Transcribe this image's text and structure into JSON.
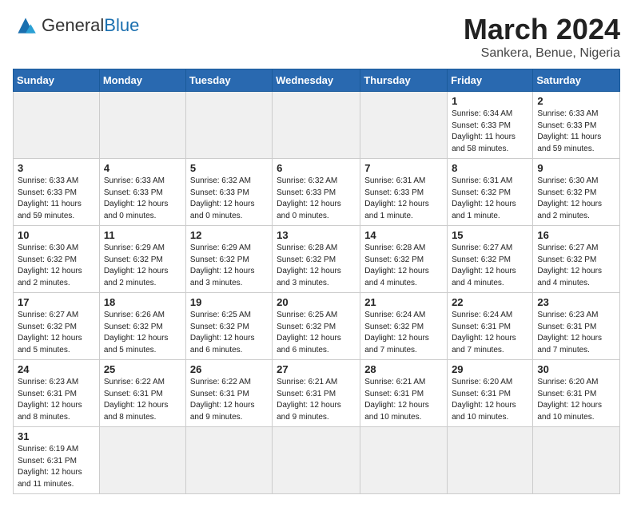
{
  "logo": {
    "text_general": "General",
    "text_blue": "Blue"
  },
  "title": "March 2024",
  "subtitle": "Sankera, Benue, Nigeria",
  "weekdays": [
    "Sunday",
    "Monday",
    "Tuesday",
    "Wednesday",
    "Thursday",
    "Friday",
    "Saturday"
  ],
  "weeks": [
    [
      {
        "day": "",
        "info": ""
      },
      {
        "day": "",
        "info": ""
      },
      {
        "day": "",
        "info": ""
      },
      {
        "day": "",
        "info": ""
      },
      {
        "day": "",
        "info": ""
      },
      {
        "day": "1",
        "info": "Sunrise: 6:34 AM\nSunset: 6:33 PM\nDaylight: 11 hours\nand 58 minutes."
      },
      {
        "day": "2",
        "info": "Sunrise: 6:33 AM\nSunset: 6:33 PM\nDaylight: 11 hours\nand 59 minutes."
      }
    ],
    [
      {
        "day": "3",
        "info": "Sunrise: 6:33 AM\nSunset: 6:33 PM\nDaylight: 11 hours\nand 59 minutes."
      },
      {
        "day": "4",
        "info": "Sunrise: 6:33 AM\nSunset: 6:33 PM\nDaylight: 12 hours\nand 0 minutes."
      },
      {
        "day": "5",
        "info": "Sunrise: 6:32 AM\nSunset: 6:33 PM\nDaylight: 12 hours\nand 0 minutes."
      },
      {
        "day": "6",
        "info": "Sunrise: 6:32 AM\nSunset: 6:33 PM\nDaylight: 12 hours\nand 0 minutes."
      },
      {
        "day": "7",
        "info": "Sunrise: 6:31 AM\nSunset: 6:33 PM\nDaylight: 12 hours\nand 1 minute."
      },
      {
        "day": "8",
        "info": "Sunrise: 6:31 AM\nSunset: 6:32 PM\nDaylight: 12 hours\nand 1 minute."
      },
      {
        "day": "9",
        "info": "Sunrise: 6:30 AM\nSunset: 6:32 PM\nDaylight: 12 hours\nand 2 minutes."
      }
    ],
    [
      {
        "day": "10",
        "info": "Sunrise: 6:30 AM\nSunset: 6:32 PM\nDaylight: 12 hours\nand 2 minutes."
      },
      {
        "day": "11",
        "info": "Sunrise: 6:29 AM\nSunset: 6:32 PM\nDaylight: 12 hours\nand 2 minutes."
      },
      {
        "day": "12",
        "info": "Sunrise: 6:29 AM\nSunset: 6:32 PM\nDaylight: 12 hours\nand 3 minutes."
      },
      {
        "day": "13",
        "info": "Sunrise: 6:28 AM\nSunset: 6:32 PM\nDaylight: 12 hours\nand 3 minutes."
      },
      {
        "day": "14",
        "info": "Sunrise: 6:28 AM\nSunset: 6:32 PM\nDaylight: 12 hours\nand 4 minutes."
      },
      {
        "day": "15",
        "info": "Sunrise: 6:27 AM\nSunset: 6:32 PM\nDaylight: 12 hours\nand 4 minutes."
      },
      {
        "day": "16",
        "info": "Sunrise: 6:27 AM\nSunset: 6:32 PM\nDaylight: 12 hours\nand 4 minutes."
      }
    ],
    [
      {
        "day": "17",
        "info": "Sunrise: 6:27 AM\nSunset: 6:32 PM\nDaylight: 12 hours\nand 5 minutes."
      },
      {
        "day": "18",
        "info": "Sunrise: 6:26 AM\nSunset: 6:32 PM\nDaylight: 12 hours\nand 5 minutes."
      },
      {
        "day": "19",
        "info": "Sunrise: 6:25 AM\nSunset: 6:32 PM\nDaylight: 12 hours\nand 6 minutes."
      },
      {
        "day": "20",
        "info": "Sunrise: 6:25 AM\nSunset: 6:32 PM\nDaylight: 12 hours\nand 6 minutes."
      },
      {
        "day": "21",
        "info": "Sunrise: 6:24 AM\nSunset: 6:32 PM\nDaylight: 12 hours\nand 7 minutes."
      },
      {
        "day": "22",
        "info": "Sunrise: 6:24 AM\nSunset: 6:31 PM\nDaylight: 12 hours\nand 7 minutes."
      },
      {
        "day": "23",
        "info": "Sunrise: 6:23 AM\nSunset: 6:31 PM\nDaylight: 12 hours\nand 7 minutes."
      }
    ],
    [
      {
        "day": "24",
        "info": "Sunrise: 6:23 AM\nSunset: 6:31 PM\nDaylight: 12 hours\nand 8 minutes."
      },
      {
        "day": "25",
        "info": "Sunrise: 6:22 AM\nSunset: 6:31 PM\nDaylight: 12 hours\nand 8 minutes."
      },
      {
        "day": "26",
        "info": "Sunrise: 6:22 AM\nSunset: 6:31 PM\nDaylight: 12 hours\nand 9 minutes."
      },
      {
        "day": "27",
        "info": "Sunrise: 6:21 AM\nSunset: 6:31 PM\nDaylight: 12 hours\nand 9 minutes."
      },
      {
        "day": "28",
        "info": "Sunrise: 6:21 AM\nSunset: 6:31 PM\nDaylight: 12 hours\nand 10 minutes."
      },
      {
        "day": "29",
        "info": "Sunrise: 6:20 AM\nSunset: 6:31 PM\nDaylight: 12 hours\nand 10 minutes."
      },
      {
        "day": "30",
        "info": "Sunrise: 6:20 AM\nSunset: 6:31 PM\nDaylight: 12 hours\nand 10 minutes."
      }
    ],
    [
      {
        "day": "31",
        "info": "Sunrise: 6:19 AM\nSunset: 6:31 PM\nDaylight: 12 hours\nand 11 minutes."
      },
      {
        "day": "",
        "info": ""
      },
      {
        "day": "",
        "info": ""
      },
      {
        "day": "",
        "info": ""
      },
      {
        "day": "",
        "info": ""
      },
      {
        "day": "",
        "info": ""
      },
      {
        "day": "",
        "info": ""
      }
    ]
  ]
}
